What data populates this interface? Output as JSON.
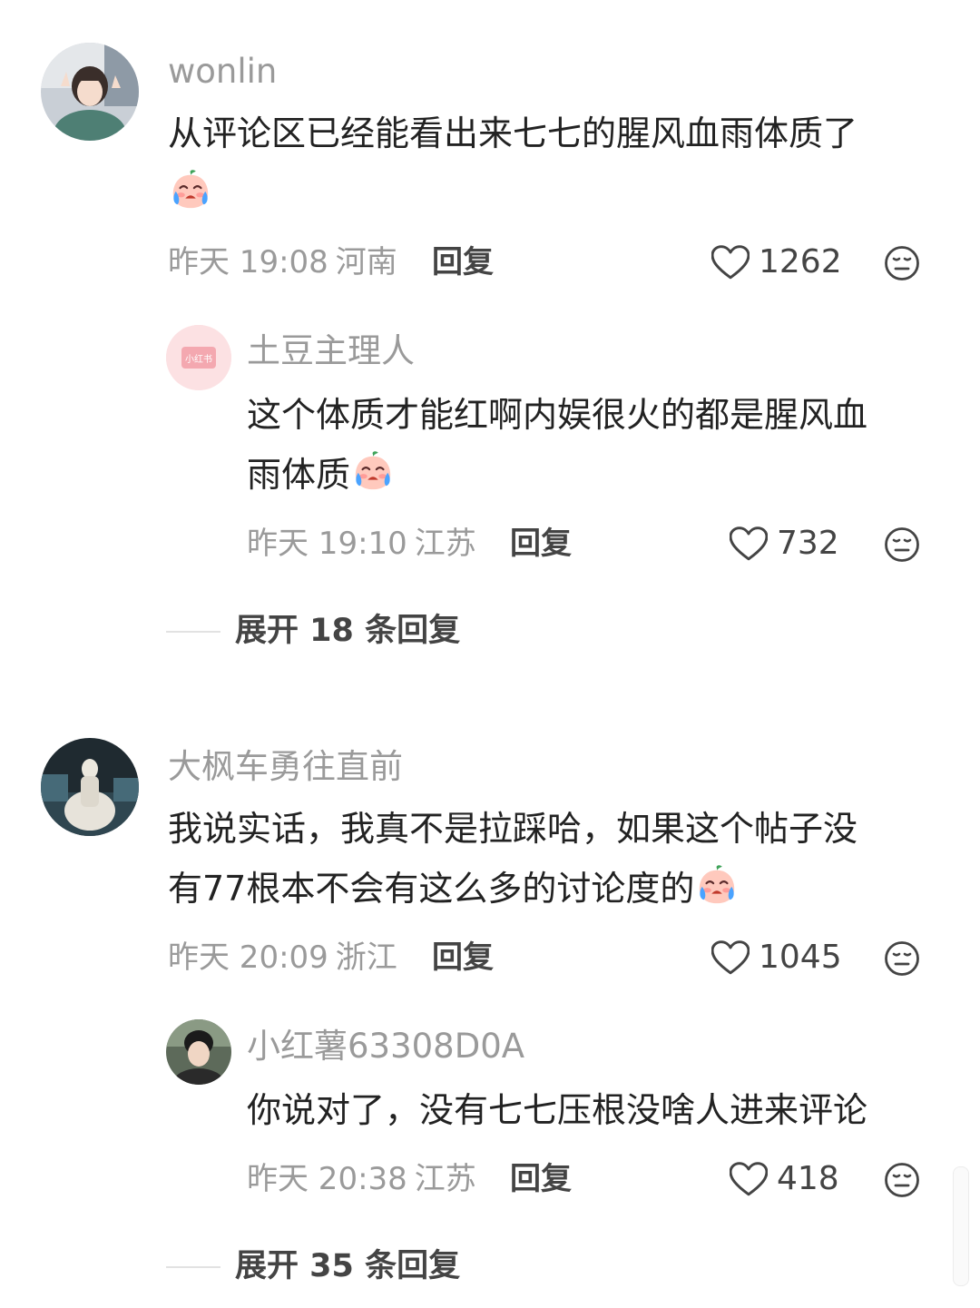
{
  "comments": [
    {
      "username": "wonlin",
      "text": "从评论区已经能看出来七七的腥风血雨体质了",
      "time": "昨天 19:08",
      "location": "河南",
      "reply_label": "回复",
      "likes": "1262",
      "emoji": "crying-face-emoji",
      "replies": [
        {
          "username": "土豆主理人",
          "avatar_text": "小红书",
          "text_line1": "这个体质才能红啊内娱很火的都是腥风血",
          "text_line2": "雨体质",
          "time": "昨天 19:10",
          "location": "江苏",
          "reply_label": "回复",
          "likes": "732",
          "emoji": "crying-face-emoji"
        }
      ],
      "expand_label": "展开 18 条回复"
    },
    {
      "username": "大枫车勇往直前",
      "text_line1": "我说实话，我真不是拉踩哈，如果这个帖子没",
      "text_line2": "有77根本不会有这么多的讨论度的",
      "time": "昨天 20:09",
      "location": "浙江",
      "reply_label": "回复",
      "likes": "1045",
      "emoji": "crying-face-emoji",
      "replies": [
        {
          "username": "小红薯63308D0A",
          "text": "你说对了，没有七七压根没啥人进来评论",
          "time": "昨天 20:38",
          "location": "江苏",
          "reply_label": "回复",
          "likes": "418"
        }
      ],
      "expand_label": "展开 35 条回复"
    }
  ],
  "colors": {
    "meta_gray": "#9a9a9a",
    "text_dark": "#222222",
    "brand_pink": "#f5c6ca"
  }
}
